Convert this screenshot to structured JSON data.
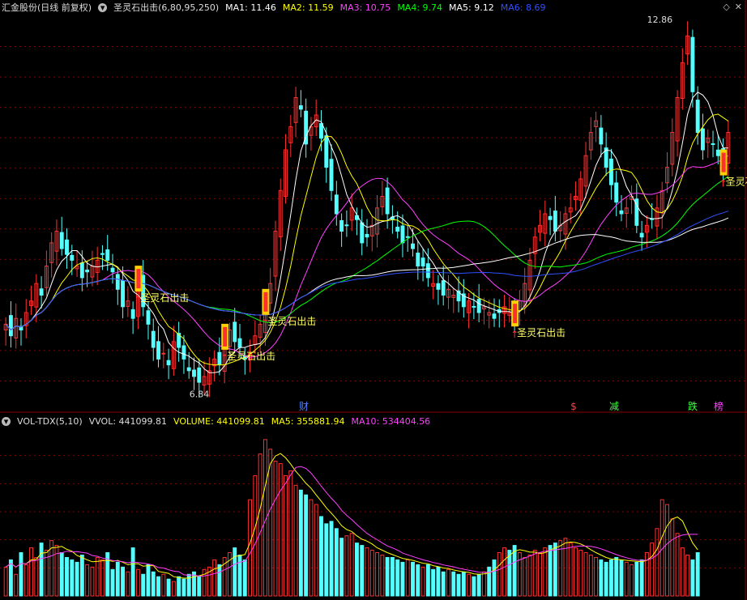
{
  "header": {
    "stock_name": "汇金股份(日线 前复权)",
    "indicator": "圣灵石出击(6,80,95,250)",
    "ma": [
      {
        "label": "MA1: 11.46",
        "color": "#ffffff"
      },
      {
        "label": "MA2: 11.59",
        "color": "#ffff00"
      },
      {
        "label": "MA3: 10.75",
        "color": "#ff40ff"
      },
      {
        "label": "MA4: 9.74",
        "color": "#00ff00"
      },
      {
        "label": "MA5: 9.12",
        "color": "#ffffff"
      },
      {
        "label": "MA6: 8.69",
        "color": "#3050ff"
      }
    ]
  },
  "sub_header": {
    "indicator": "VOL-TDX(5,10)",
    "vvol": "VVOL: 441099.81",
    "volume": "VOLUME: 441099.81",
    "ma5": "MA5: 355881.94",
    "ma10": "MA10: 534404.56"
  },
  "annotations": {
    "high_label": "12.86",
    "low_label": "6.84",
    "signal_text": "圣灵石出击",
    "signal_text_cut": "圣灵石",
    "event_marks": [
      "财",
      "$",
      "减",
      "跌",
      "榜"
    ]
  },
  "colors": {
    "up": "#ff3030",
    "down": "#54ffff",
    "grid": "#8b0000",
    "ma1": "#ffffff",
    "ma2": "#ffff00",
    "ma3": "#ff40ff",
    "ma4": "#00ff00",
    "ma5": "#ffffff",
    "ma6": "#3050ff",
    "vol_ma5": "#ffff00",
    "vol_ma10": "#ff40ff"
  },
  "chart_data": {
    "type": "candlestick",
    "candles_close": [
      7.9,
      7.7,
      8.0,
      7.8,
      8.1,
      8.3,
      8.6,
      8.4,
      8.9,
      9.3,
      9.5,
      9.2,
      9.1,
      9.0,
      8.9,
      8.7,
      8.8,
      8.9,
      9.0,
      9.1,
      9.0,
      8.8,
      8.5,
      8.2,
      8.3,
      8.0,
      8.6,
      8.2,
      7.9,
      7.5,
      7.3,
      7.4,
      7.2,
      7.6,
      7.5,
      7.3,
      7.1,
      7.0,
      6.9,
      7.0,
      7.1,
      7.3,
      7.2,
      7.6,
      7.8,
      7.6,
      7.5,
      7.3,
      7.4,
      7.7,
      7.9,
      8.2,
      8.6,
      9.5,
      10.2,
      10.9,
      11.3,
      11.8,
      11.6,
      11.0,
      11.3,
      11.5,
      11.1,
      10.6,
      10.2,
      9.8,
      9.5,
      9.6,
      9.9,
      9.7,
      9.3,
      9.4,
      9.6,
      9.9,
      10.1,
      9.8,
      9.7,
      9.5,
      9.3,
      9.4,
      9.2,
      8.9,
      8.9,
      8.7,
      8.6,
      8.5,
      8.4,
      8.5,
      8.4,
      8.3,
      8.2,
      8.3,
      8.2,
      8.1,
      8.2,
      8.1,
      8.0,
      8.1,
      8.2,
      8.1,
      8.0,
      8.3,
      8.6,
      9.0,
      9.4,
      9.6,
      9.8,
      9.7,
      9.5,
      9.6,
      9.8,
      9.9,
      10.1,
      10.4,
      10.8,
      11.2,
      11.4,
      11.0,
      10.6,
      10.3,
      10.0,
      9.8,
      9.9,
      10.1,
      9.6,
      9.4,
      9.6,
      9.7,
      9.9,
      10.2,
      10.6,
      11.2,
      11.8,
      12.4,
      12.86,
      11.9,
      11.2,
      10.9,
      11.1,
      11.0,
      10.8,
      10.6,
      11.2
    ],
    "volume": [
      120,
      150,
      90,
      180,
      130,
      200,
      160,
      220,
      190,
      230,
      210,
      180,
      160,
      150,
      140,
      170,
      130,
      120,
      160,
      150,
      180,
      110,
      140,
      120,
      100,
      200,
      110,
      90,
      130,
      100,
      80,
      90,
      70,
      60,
      80,
      70,
      90,
      100,
      80,
      110,
      120,
      150,
      130,
      160,
      180,
      200,
      170,
      150,
      400,
      500,
      590,
      650,
      610,
      560,
      550,
      500,
      520,
      460,
      440,
      420,
      400,
      380,
      330,
      300,
      310,
      280,
      240,
      250,
      260,
      220,
      210,
      200,
      190,
      180,
      170,
      160,
      160,
      150,
      140,
      150,
      140,
      130,
      120,
      130,
      110,
      120,
      100,
      110,
      100,
      90,
      100,
      90,
      80,
      90,
      100,
      120,
      150,
      180,
      200,
      190,
      210,
      180,
      160,
      170,
      190,
      180,
      200,
      210,
      220,
      230,
      240,
      220,
      200,
      190,
      180,
      170,
      160,
      150,
      140,
      150,
      160,
      150,
      140,
      130,
      140,
      150,
      180,
      220,
      280,
      400,
      380,
      320,
      260,
      200,
      170,
      150,
      180
    ]
  }
}
